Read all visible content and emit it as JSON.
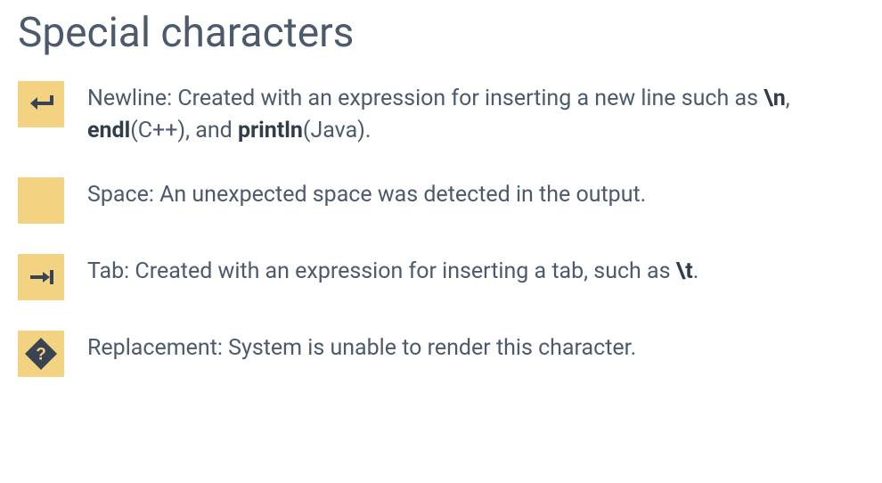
{
  "heading": "Special characters",
  "items": {
    "newline": {
      "pre1": "Newline: Created with an expression for inserting a new line such as ",
      "code1": "\\n",
      "mid1": ", ",
      "code2": "endl",
      "mid2": "(C++), and ",
      "code3": "println",
      "post": "(Java)."
    },
    "space": {
      "text": "Space: An unexpected space was detected in the output."
    },
    "tab": {
      "pre": "Tab: Created with an expression for inserting a tab, such as ",
      "code": "\\t",
      "post": "."
    },
    "replacement": {
      "text": "Replacement: System is unable to render this character."
    }
  }
}
